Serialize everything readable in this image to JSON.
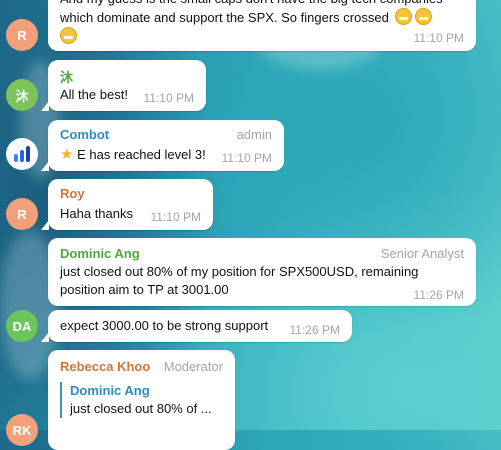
{
  "messages": [
    {
      "avatar": "R",
      "lines": [
        "And my guess is the small caps don't have the big tech companies",
        "which dominate and support the SPX.  So fingers crossed"
      ],
      "time": "11:10 PM"
    },
    {
      "sender": "沐",
      "avatar": "沐",
      "text": "All the best!",
      "time": "11:10 PM"
    },
    {
      "sender": "Combot",
      "role": "admin",
      "text": "E has reached level 3!",
      "time": "11:10 PM"
    },
    {
      "sender": "Roy",
      "avatar": "R",
      "text": "Haha thanks",
      "time": "11:10 PM"
    },
    {
      "sender": "Dominic Ang",
      "role": "Senior Analyst",
      "lines": [
        "just closed out 80% of my position for SPX500USD, remaining",
        "position aim to TP at 3001.00"
      ],
      "time": "11:26 PM"
    },
    {
      "avatar": "DA",
      "text": "expect 3000.00 to be strong support",
      "time": "11:26 PM"
    },
    {
      "sender": "Rebecca Khoo",
      "role": "Moderator",
      "reply_sender": "Dominic Ang",
      "reply_text": "just closed out 80% of ...",
      "avatar": "RK"
    }
  ],
  "colors": {
    "avatar_r": "#f2a07b",
    "avatar_mu": "#7cc35a",
    "avatar_da": "#6cc55a",
    "name_green": "#4ea83b",
    "name_blue": "#2f8ac4",
    "name_orange": "#d4743a"
  }
}
